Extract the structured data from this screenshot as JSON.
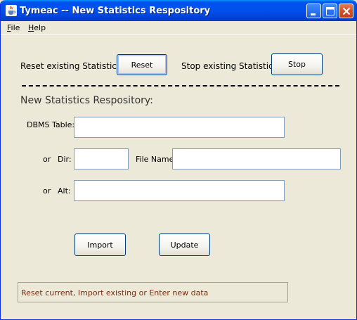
{
  "window": {
    "title": "Tymeac -- New Statistics Respository",
    "icon": "java-cup-icon"
  },
  "menubar": {
    "items": [
      {
        "label": "File",
        "mnemonic": "F",
        "rest": "ile"
      },
      {
        "label": "Help",
        "mnemonic": "H",
        "rest": "elp"
      }
    ]
  },
  "reset_row": {
    "label": "Reset existing Statistics:",
    "button": "Reset",
    "stop_label": "Stop existing Statistics:",
    "stop_button": "Stop"
  },
  "section_title": "New Statistics Respository:",
  "form": {
    "dbms_label": "DBMS Table:",
    "dbms_value": "",
    "or1": "or",
    "dir_label": "Dir:",
    "dir_value": "",
    "file_name_label": "File Name:",
    "file_name_value": "",
    "or2": "or",
    "alt_label": "Alt:",
    "alt_value": ""
  },
  "actions": {
    "import": "Import",
    "update": "Update"
  },
  "status": "Reset current, Import existing or Enter new data",
  "colors": {
    "titlebar": "#0053EE",
    "background": "#ECE9D8",
    "status_text": "#7A2C10"
  }
}
